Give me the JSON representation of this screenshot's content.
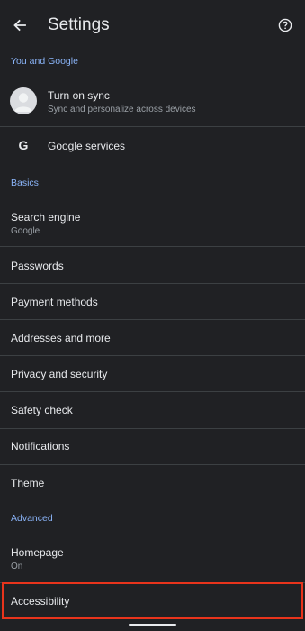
{
  "app_bar": {
    "title": "Settings",
    "back_icon": "arrow-left-icon",
    "help_icon": "help-circle-icon"
  },
  "sections": {
    "you_and_google": "You and Google",
    "basics": "Basics",
    "advanced": "Advanced"
  },
  "sync": {
    "title": "Turn on sync",
    "subtitle": "Sync and personalize across devices"
  },
  "google_services": {
    "icon_glyph": "G",
    "label": "Google services"
  },
  "basics_items": {
    "search_engine": {
      "label": "Search engine",
      "value": "Google"
    },
    "passwords": "Passwords",
    "payment_methods": "Payment methods",
    "addresses": "Addresses and more",
    "privacy": "Privacy and security",
    "safety_check": "Safety check",
    "notifications": "Notifications",
    "theme": "Theme"
  },
  "advanced_items": {
    "homepage": {
      "label": "Homepage",
      "value": "On"
    },
    "accessibility": "Accessibility"
  },
  "colors": {
    "background": "#202124",
    "section_header": "#8ab4f8",
    "highlight_border": "#e8341c",
    "divider": "#3c4043"
  }
}
